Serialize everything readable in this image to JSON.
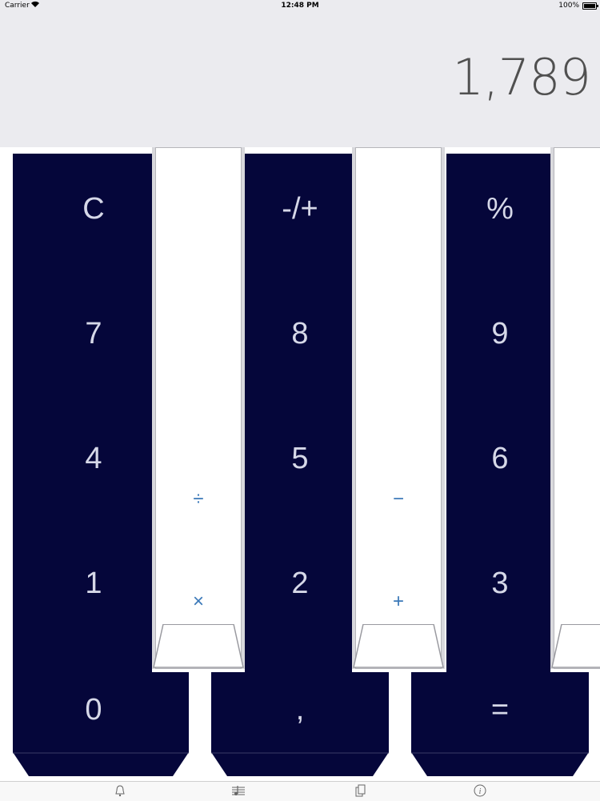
{
  "status": {
    "carrier": "Carrier",
    "time": "12:48 PM",
    "battery": "100%"
  },
  "display": {
    "value": "1,789"
  },
  "keys": {
    "clear": "C",
    "sign": "-/+",
    "percent": "%",
    "seven": "7",
    "eight": "8",
    "nine": "9",
    "four": "4",
    "five": "5",
    "six": "6",
    "one": "1",
    "two": "2",
    "three": "3",
    "zero": "0",
    "decimal": ",",
    "equals": "="
  },
  "operators": {
    "divide": "÷",
    "multiply": "×",
    "minus": "−",
    "plus": "+"
  },
  "tabs": [
    {
      "icon": "bell-icon"
    },
    {
      "icon": "music-score-icon"
    },
    {
      "icon": "copy-icon"
    },
    {
      "icon": "info-icon"
    }
  ],
  "colors": {
    "black_key": "#05063a",
    "operator": "#3a78b8",
    "display_bg": "#ebebef"
  }
}
